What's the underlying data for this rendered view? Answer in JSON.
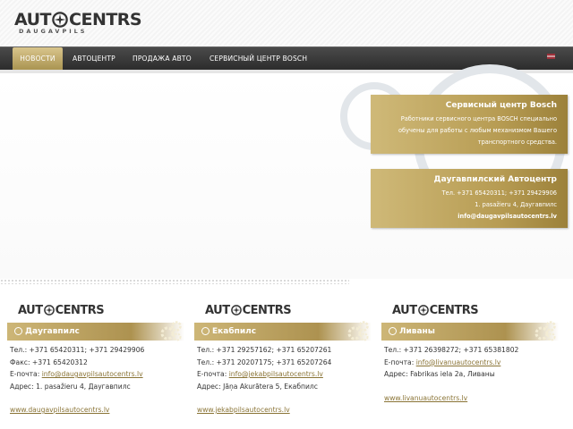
{
  "logo": {
    "main_left": "AUT",
    "main_right": "CENTRS",
    "sub": "DAUGAVPILS"
  },
  "nav": [
    {
      "label": "НОВОСТИ"
    },
    {
      "label": "АВТОЦЕНТР"
    },
    {
      "label": "ПРОДАЖА АВТО"
    },
    {
      "label": "СЕРВИСНЫЙ ЦЕНТР BOSCH"
    }
  ],
  "colors": {
    "gold": "#b79c53",
    "nav_dark": "#2b2b2b",
    "link": "#8a7436"
  },
  "cards": {
    "bosch": {
      "title": "Сервисный центр Bosch",
      "text": "Работники сервисного центра BOSCH специально обучены для работы с любым механизмом Вашего транспортного средства."
    },
    "autocenter": {
      "title": "Даугавпилский Автоцентр",
      "phone": "Тел.  +371 65420311; +371 29429906",
      "address": "1. pasažieru 4, Даугавпилс",
      "email": "info@daugavpilsautocentrs.lv"
    }
  },
  "branches": [
    {
      "city": "Даугавпилс",
      "lines": [
        "Тел.: +371 65420311; +371 29429906",
        "Факс: +371 65420312"
      ],
      "email_label": "E-почта: ",
      "email": "info@daugavpilsautocentrs.lv",
      "address": "Адрес: 1. pasažieru 4, Даугавпилс",
      "website": "www.daugavpilsautocentrs.lv"
    },
    {
      "city": "Екабпилс",
      "lines": [
        "Тел.: +371 29257162; +371 65207261",
        "Тел.: +371 20207175; +371 65207264"
      ],
      "email_label": "E-почта: ",
      "email": "info@jekabpilsautocentrs.lv",
      "address": "Адрес: Jāņa Akurātera 5, Екабпилс",
      "website": "www.jekabpilsautocentrs.lv"
    },
    {
      "city": "Ливаны",
      "lines": [
        "Тел.: +371 26398272; +371 65381802"
      ],
      "email_label": "E-почта: ",
      "email": "info@livanuautocentrs.lv",
      "address": "Адрес: Fabrikas iela 2a, Ливаны",
      "website": "www.livanuautocentrs.lv"
    }
  ]
}
